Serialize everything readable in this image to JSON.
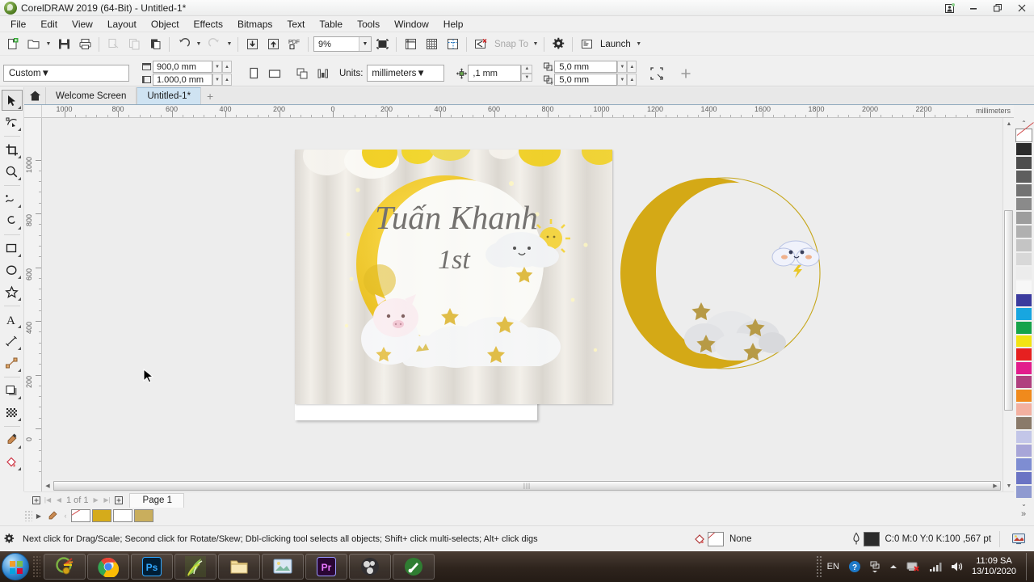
{
  "window": {
    "title": "CorelDRAW 2019 (64-Bit) - Untitled-1*",
    "app_icon": "coreldraw-balloon-icon",
    "buttons": {
      "restore_session": "restore-session-icon",
      "minimize": "minimize-icon",
      "maximize": "maximize-icon",
      "close": "close-icon"
    }
  },
  "menubar": {
    "items": [
      {
        "label": "File"
      },
      {
        "label": "Edit"
      },
      {
        "label": "View"
      },
      {
        "label": "Layout"
      },
      {
        "label": "Object"
      },
      {
        "label": "Effects"
      },
      {
        "label": "Bitmaps"
      },
      {
        "label": "Text"
      },
      {
        "label": "Table"
      },
      {
        "label": "Tools"
      },
      {
        "label": "Window"
      },
      {
        "label": "Help"
      }
    ]
  },
  "standard_toolbar": {
    "buttons": [
      {
        "name": "new-document-button",
        "icon": "new-page-icon"
      },
      {
        "name": "open-document-button",
        "icon": "open-folder-icon"
      },
      {
        "name": "save-document-button",
        "icon": "floppy-save-icon"
      },
      {
        "name": "print-button",
        "icon": "printer-icon"
      },
      {
        "name": "cut-button",
        "icon": "cut-icon"
      },
      {
        "name": "copy-button",
        "icon": "copy-icon"
      },
      {
        "name": "paste-button",
        "icon": "paste-icon"
      },
      {
        "name": "undo-button",
        "icon": "undo-arrow-icon"
      },
      {
        "name": "redo-button",
        "icon": "redo-arrow-icon"
      },
      {
        "name": "import-button",
        "icon": "import-down-arrow-icon"
      },
      {
        "name": "export-button",
        "icon": "export-up-arrow-icon"
      },
      {
        "name": "publish-pdf-button",
        "icon": "pdf-icon"
      }
    ],
    "zoom_level": "9%",
    "fullscreen_preview": "fullscreen-preview-icon",
    "show_rulers": "show-rulers-icon",
    "show_grid": "show-grid-icon",
    "show_guidelines": "show-guidelines-icon",
    "snap_toggle": "snap-off-icon",
    "snap_to_label": "Snap To",
    "options_label": "options-gear-icon",
    "launch_label": "Launch"
  },
  "property_bar": {
    "page_preset": "Custom",
    "page_width": "900,0 mm",
    "page_height": "1.000,0 mm",
    "portrait_icon": "portrait-orientation-icon",
    "landscape_icon": "landscape-orientation-icon",
    "all_pages_icon": "all-pages-icon",
    "current_page_icon": "current-page-only-icon",
    "units_label": "Units:",
    "units_value": "millimeters",
    "nudge_icon": "nudge-offset-icon",
    "nudge_value": ",1 mm",
    "duplicate_x_label": "duplicate-distance-x-icon",
    "duplicate_x_value": "5,0 mm",
    "duplicate_y_label": "duplicate-distance-y-icon",
    "duplicate_y_value": "5,0 mm",
    "bleed_icon": "page-bleed-icon",
    "add_icon": "add-toolbar-item-icon"
  },
  "document_tabs": {
    "home_icon": "home-icon",
    "tabs": [
      {
        "label": "Welcome Screen",
        "active": false
      },
      {
        "label": "Untitled-1*",
        "active": true
      }
    ],
    "new_tab": "+"
  },
  "toolbox": {
    "tools": [
      {
        "name": "pick-tool",
        "icon": "arrow-cursor-icon",
        "active": true
      },
      {
        "name": "shape-tool",
        "icon": "node-edit-icon",
        "active": false
      },
      {
        "name": "crop-tool",
        "icon": "crop-icon",
        "active": false
      },
      {
        "name": "zoom-tool",
        "icon": "magnifier-icon",
        "active": false
      },
      {
        "name": "freehand-tool",
        "icon": "freehand-curve-icon",
        "active": false
      },
      {
        "name": "smart-fill-tool",
        "icon": "smart-drawing-icon",
        "active": false
      },
      {
        "name": "rectangle-tool",
        "icon": "rectangle-icon",
        "active": false
      },
      {
        "name": "ellipse-tool",
        "icon": "ellipse-icon",
        "active": false
      },
      {
        "name": "polygon-tool",
        "icon": "star-icon",
        "active": false
      },
      {
        "name": "text-tool",
        "icon": "text-a-icon",
        "active": false
      },
      {
        "name": "parallel-dimension-tool",
        "icon": "dimension-line-icon",
        "active": false
      },
      {
        "name": "connector-tool",
        "icon": "straight-connector-icon",
        "active": false
      },
      {
        "name": "drop-shadow-tool",
        "icon": "drop-shadow-icon",
        "active": false
      },
      {
        "name": "transparency-tool",
        "icon": "transparency-checker-icon",
        "active": false
      },
      {
        "name": "color-eyedropper-tool",
        "icon": "eyedropper-icon",
        "active": false
      },
      {
        "name": "interactive-fill-tool",
        "icon": "fill-bucket-icon",
        "active": false
      }
    ]
  },
  "rulers": {
    "units": "millimeters",
    "horizontal_labels": [
      "1000",
      "800",
      "600",
      "400",
      "200",
      "0",
      "200",
      "400",
      "600",
      "800",
      "1000",
      "1200",
      "1400",
      "1600",
      "1800",
      "2000",
      "2200"
    ],
    "vertical_labels": [
      "1000",
      "800",
      "600",
      "400",
      "200",
      "0"
    ]
  },
  "canvas": {
    "photo_title_line1": "Tuấn Khanh",
    "photo_title_line2": "1st",
    "cursor": "arrow-pointer-cursor",
    "colors": {
      "moon_yellow": "#d9ad17",
      "cloud_white": "#e3e4e6",
      "star_gold": "#c9a94b",
      "canvas_bg": "#ededed"
    }
  },
  "page_bar": {
    "add_page_left": "add-page-before-icon",
    "first_page": "first-page-icon",
    "prev_page": "previous-page-icon",
    "counter": "1  of  1",
    "next_page": "next-page-icon",
    "last_page": "last-page-icon",
    "add_page_right": "add-page-after-icon",
    "page_tab": "Page 1",
    "zoom_icon": "zoom-to-fit-icon"
  },
  "palette_strip": {
    "expand_icon": "expand-palette-icon",
    "eyedropper_icon": "palette-eyedropper-icon",
    "swatches": [
      "none",
      "#d5ab1b",
      "#ffffff",
      "#c9ae5d"
    ]
  },
  "status_bar": {
    "hint_icon": "status-gear-icon",
    "hint": "Next click for Drag/Scale; Second click for Rotate/Skew; Dbl-clicking tool selects all objects; Shift+ click multi-selects; Alt+ click digs",
    "fill_icon": "fill-color-icon",
    "fill_value": "None",
    "outline_icon": "outline-pen-icon",
    "outline_color": "#2b2b2b",
    "outline_value": "C:0 M:0 Y:0 K:100  ,567 pt",
    "display_icon": "color-proof-icon"
  },
  "color_palette": {
    "scroll_up": "palette-scroll-up-icon",
    "scroll_down": "palette-scroll-down-icon",
    "colors": [
      "none",
      "#2b2b2b",
      "#4d4d4d",
      "#5e5e5e",
      "#737373",
      "#8a8a8a",
      "#9d9d9d",
      "#b0b0b0",
      "#c4c4c4",
      "#d8d8d8",
      "#ececec",
      "#f7f7f7",
      "#3b3b9e",
      "#18a6e0",
      "#16a34a",
      "#f2e313",
      "#e62020",
      "#e21c8c",
      "#b0407f",
      "#f08a1c",
      "#f3b0a0",
      "#8a7a6a",
      "#c3c6e8",
      "#a8a6d8",
      "#7e8dd2",
      "#6b74c4",
      "#8f9ad0"
    ]
  },
  "taskbar": {
    "start": "windows-start-orb",
    "items": [
      {
        "name": "taskitem-coreldraw",
        "icon": "coreldraw-icon"
      },
      {
        "name": "taskitem-chrome",
        "icon": "chrome-icon"
      },
      {
        "name": "taskitem-photoshop",
        "icon": "photoshop-icon"
      },
      {
        "name": "taskitem-corel-leaf",
        "icon": "corel-leaf-icon"
      },
      {
        "name": "taskitem-explorer",
        "icon": "folder-icon"
      },
      {
        "name": "taskitem-photo-viewer",
        "icon": "picture-icon"
      },
      {
        "name": "taskitem-premiere",
        "icon": "premiere-icon"
      },
      {
        "name": "taskitem-obs",
        "icon": "obs-icon"
      },
      {
        "name": "taskitem-corel-capture",
        "icon": "green-disc-icon"
      }
    ],
    "tray": {
      "language": "EN",
      "help_icon": "help-question-icon",
      "hidden_icons": "show-hidden-icons-icon",
      "network_icon": "network-error-icon",
      "signal_icon": "signal-bars-icon",
      "volume_icon": "volume-icon",
      "time": "11:09 SA",
      "date": "13/10/2020"
    }
  }
}
